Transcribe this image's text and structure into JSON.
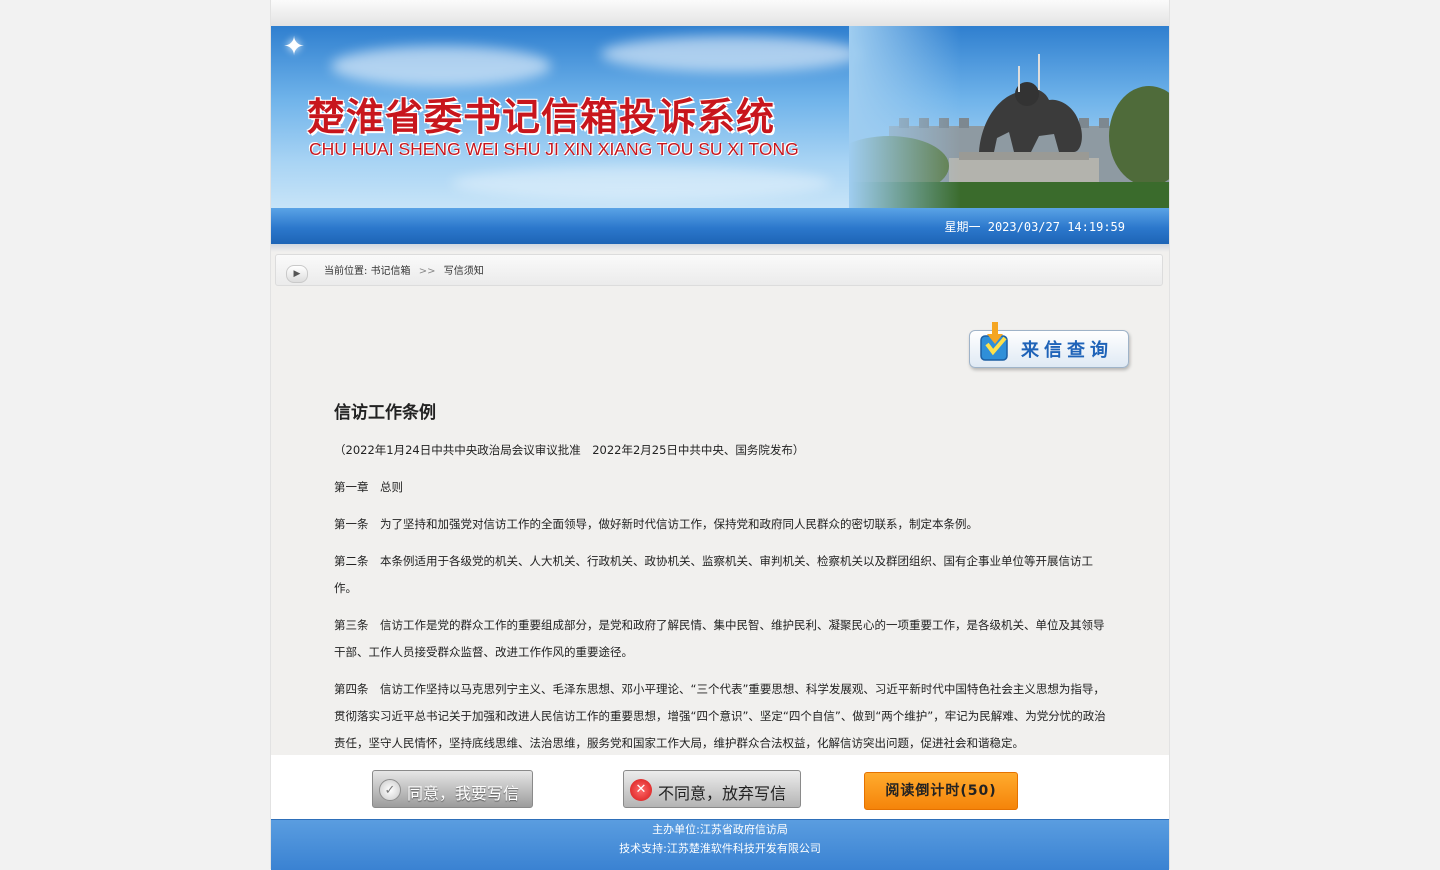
{
  "header": {
    "title_cn": "楚淮省委书记信箱投诉系统",
    "title_en": "CHU HUAI SHENG WEI SHU JI XIN XIANG TOU SU XI TONG",
    "datetime": "星期一 2023/03/27 14:19:59"
  },
  "breadcrumb": {
    "prefix": "当前位置:",
    "items": [
      "书记信箱",
      "写信须知"
    ],
    "separator": ">>"
  },
  "query_button": {
    "label": "来信查询",
    "icon": "download-arrow-icon"
  },
  "article": {
    "title": "信访工作条例",
    "subtitle": "（2022年1月24日中共中央政治局会议审议批准　2022年2月25日中共中央、国务院发布）",
    "paragraphs": [
      "第一章　总则",
      "第一条　为了坚持和加强党对信访工作的全面领导，做好新时代信访工作，保持党和政府同人民群众的密切联系，制定本条例。",
      "第二条　本条例适用于各级党的机关、人大机关、行政机关、政协机关、监察机关、审判机关、检察机关以及群团组织、国有企事业单位等开展信访工作。",
      "第三条　信访工作是党的群众工作的重要组成部分，是党和政府了解民情、集中民智、维护民利、凝聚民心的一项重要工作，是各级机关、单位及其领导干部、工作人员接受群众监督、改进工作作风的重要途径。",
      "第四条　信访工作坚持以马克思列宁主义、毛泽东思想、邓小平理论、“三个代表”重要思想、科学发展观、习近平新时代中国特色社会主义思想为指导，贯彻落实习近平总书记关于加强和改进人民信访工作的重要思想，增强“四个意识”、坚定“四个自信”、做到“两个维护”，牢记为民解难、为党分忧的政治责任，坚守人民情怀，坚持底线思维、法治思维，服务党和国家工作大局，维护群众合法权益，化解信访突出问题，促进社会和谐稳定。"
    ]
  },
  "actions": {
    "agree": "同意，我要写信",
    "disagree": "不同意，放弃写信",
    "countdown": "阅读倒计时(50)"
  },
  "footer": {
    "sponsor": "主办单位:江苏省政府信访局",
    "support": "技术支持:江苏楚淮软件科技开发有限公司"
  },
  "colors": {
    "title_red": "#c8161d",
    "banner_blue": "#2c78cc",
    "countdown_orange": "#f5840a",
    "footer_blue": "#3a82d2"
  }
}
